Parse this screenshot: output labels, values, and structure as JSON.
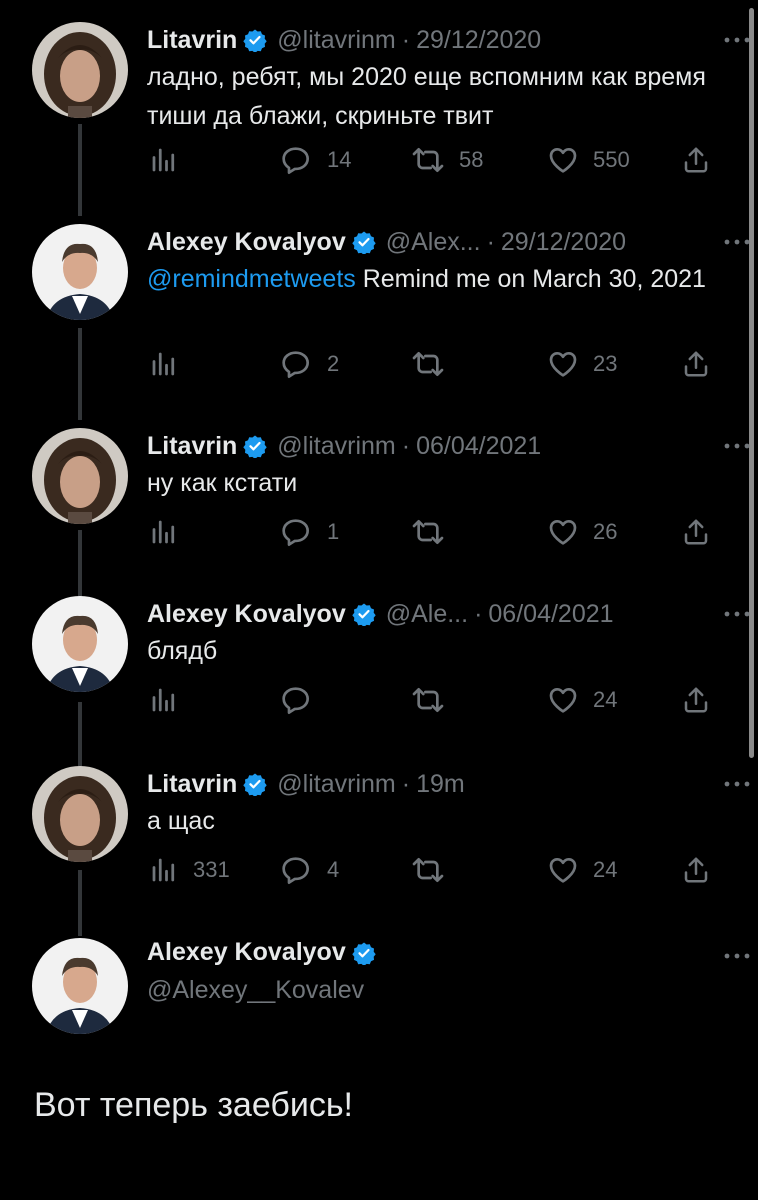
{
  "colors": {
    "background": "#000000",
    "text": "#e7e9ea",
    "muted": "#71767b",
    "accent": "#1d9bf0",
    "thread_line": "#333639"
  },
  "tweets": [
    {
      "name": "Litavrin",
      "handle": "@litavrinm",
      "separator": "·",
      "date": "29/12/2020",
      "text": "ладно, ребят, мы 2020 еще вспомним как время тиши да блажи, скриньте твит",
      "views": "",
      "replies": "14",
      "retweets": "58",
      "likes": "550"
    },
    {
      "name": "Alexey Kovalyov",
      "handle": "@Alex...",
      "separator": "·",
      "date": "29/12/2020",
      "mention": "@remindmetweets",
      "text": " Remind me on March 30, 2021",
      "views": "",
      "replies": "2",
      "retweets": "",
      "likes": "23"
    },
    {
      "name": "Litavrin",
      "handle": "@litavrinm",
      "separator": "·",
      "date": "06/04/2021",
      "text": "ну как кстати",
      "views": "",
      "replies": "1",
      "retweets": "",
      "likes": "26"
    },
    {
      "name": "Alexey Kovalyov",
      "handle": "@Ale...",
      "separator": "·",
      "date": "06/04/2021",
      "text": "блядб",
      "views": "",
      "replies": "",
      "retweets": "",
      "likes": "24"
    },
    {
      "name": "Litavrin",
      "handle": "@litavrinm",
      "separator": "·",
      "date": "19m",
      "text": "а щас",
      "views": "331",
      "replies": "4",
      "retweets": "",
      "likes": "24"
    }
  ],
  "final_tweet": {
    "name": "Alexey Kovalyov",
    "handle": "@Alexey__Kovalev",
    "text": "Вот теперь заебись!"
  },
  "icons": [
    "verified-badge-icon",
    "more-icon",
    "views-icon",
    "reply-icon",
    "retweet-icon",
    "like-icon",
    "share-icon"
  ]
}
